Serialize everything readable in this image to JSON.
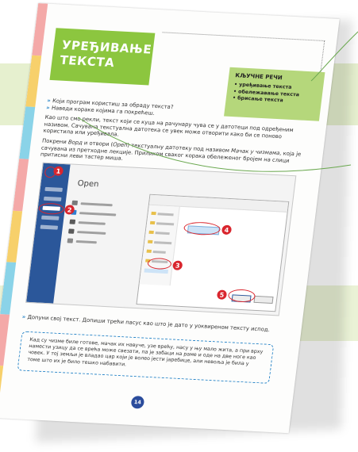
{
  "colors": {
    "title_bg": "#8cc63f",
    "keywords_bg": "#b5d77b",
    "bullet": "#2a86c8",
    "badge": "#d9262e",
    "page_number_bg": "#2b4c9c",
    "word_blue": "#2b579a",
    "strip": [
      "#f4a9a8",
      "#f7d06b",
      "#8ad3e8",
      "#f4a9a8",
      "#f7d06b",
      "#8ad3e8",
      "#f4a9a8",
      "#f7d06b"
    ]
  },
  "title": "УРЕЂИВАЊЕ ТЕКСТА",
  "keywords": {
    "heading": "КЉУЧНЕ РЕЧИ",
    "items": [
      "• уређивање текста",
      "• обележавање текста",
      "• брисање текста"
    ]
  },
  "questions": [
    "Који програм користиш за обраду текста?",
    "Наведи кораке којима га покрећеш."
  ],
  "paragraph_1": "Као што смо рекли, текст који се куца на рачунару чува се у датотеци под одређеним називом. Сачувана текстуална датотека се увек може отворити како би се поново користила или уређивала.",
  "paragraph_2": {
    "part_1": "Покрени ",
    "word": "Ворд",
    "part_2": " и отвори (",
    "open": "Open",
    "part_3": ") текстуалну датотеку под називом ",
    "filename": "Мачак у чизмама",
    "part_4": ", која је сачувана из претходне лекције. Приликом сваког корака обележеног бројем на слици притисни леви тастер миша."
  },
  "screenshot": {
    "open_title": "Open",
    "badges": [
      "1",
      "2",
      "3",
      "4",
      "5"
    ]
  },
  "instruction": "Допуни свој текст. Допиши трећи пасус као што је дато у уоквиреном тексту испод.",
  "story": "Кад су чизме биле готове, мачак их навуче, узе врећу, насу у њу мало жита, а при врху намести узицу да се врећа може свезати, па је забаци на раме и оде на две ноге као човек. У тој земљи је владао цар који је волео јести јаребице, али невоља је била у томе што их је било тешко набавити.",
  "page_number": "14"
}
